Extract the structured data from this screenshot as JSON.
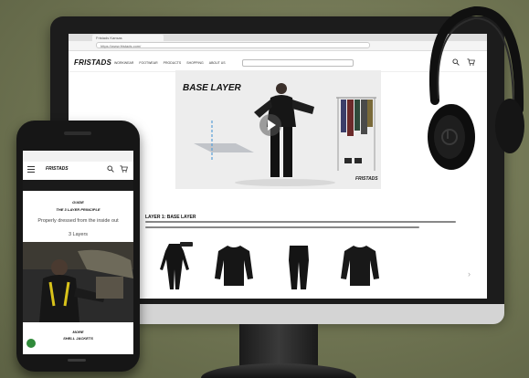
{
  "desktop": {
    "browser_tab": "Fristads Kansas",
    "url": "https://www.fristads.com/",
    "site": {
      "brand": "FRISTADS",
      "nav": [
        "WORKWEAR",
        "FOOTWEAR",
        "PRODUCTS",
        "SHOPPING",
        "ABOUT US"
      ]
    },
    "hero": {
      "title": "BASE LAYER",
      "brand_mark": "FRISTADS"
    },
    "section_title": "LAYER 1: BASE LAYER"
  },
  "phone": {
    "brand": "FRISTADS",
    "guide_label": "GUIDE",
    "principle_label": "THE 3 LAYER PRINCIPLE",
    "tagline": "Properly dressed from the inside out",
    "layer_label": "3 Layers",
    "more_label": "MORE",
    "shell_label": "SHELL JACKETS"
  },
  "colors": {
    "background": "#6f7452",
    "device_black": "#1c1c1c",
    "badge_green": "#2f8a3a"
  },
  "icons": [
    "play-icon",
    "search-icon",
    "cart-icon",
    "menu-icon",
    "chevron-right-icon",
    "beats-logo-icon"
  ]
}
